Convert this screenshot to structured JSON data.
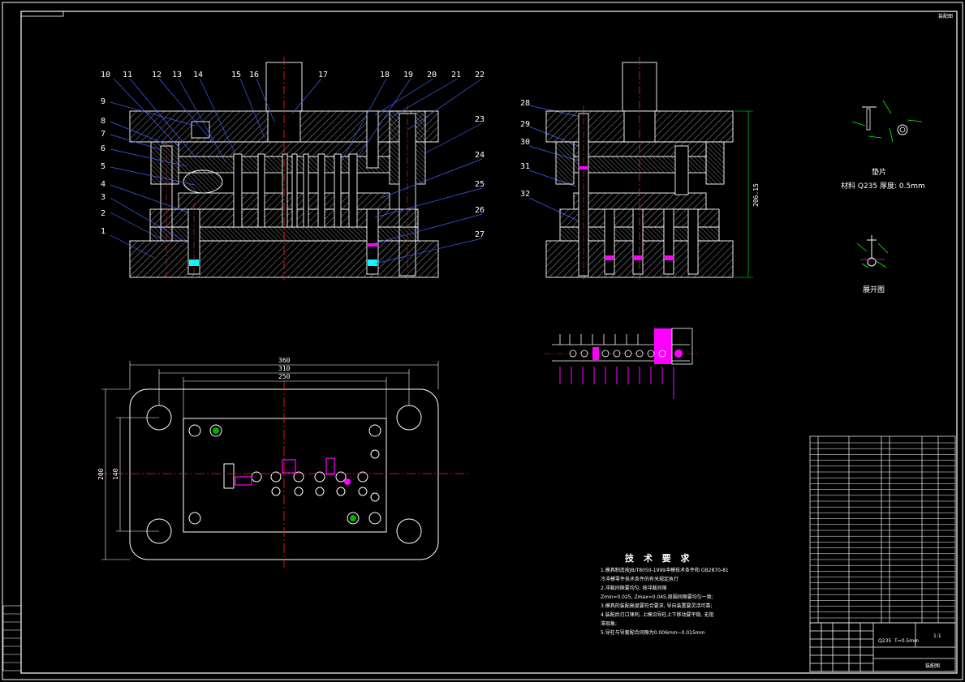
{
  "drawing": {
    "corner_tag": "装配图",
    "part_labels_left": [
      "1",
      "2",
      "3",
      "4",
      "5",
      "6",
      "7",
      "8",
      "9"
    ],
    "part_labels_top": [
      "10",
      "11",
      "12",
      "13",
      "14",
      "15",
      "16",
      "17",
      "18",
      "19",
      "20",
      "21",
      "22"
    ],
    "part_labels_right": [
      "23",
      "24",
      "25",
      "26",
      "27"
    ],
    "part_labels_side": [
      "28",
      "29",
      "30",
      "31",
      "32"
    ],
    "height_dim": "206.15",
    "dim_width_outer": "360",
    "dim_width_mid": "310",
    "dim_width_inner": "250",
    "dim_height_outer": "200",
    "dim_height_inner": "140"
  },
  "part_view": {
    "title": "垫片",
    "material_line": "材料 Q235  厚度: 0.5mm",
    "unfold_title": "展开图"
  },
  "tech_requirements": {
    "title": "技 术 要 求",
    "lines": [
      "1.模具制造按JB/T8050-1999冲模技术条件和 GB2870-81",
      "冷冲模零件技术条件的有关规定执行",
      "2.冲裁间隙要均匀, 按冲裁间隙",
      "Zmin=0.025, Zmax=0.045,周围间隙要均匀一致;",
      "3.模具的装配高度要符合要求, 导向装置要灵活可靠;",
      "4.装配后刃口锋利, 上模沿导柱上下移动要平稳, 无阻",
      "滞现象;",
      "5.导柱与导套配合间隙为0.006mm~0.015mm"
    ]
  },
  "title_block": {
    "drawing_name": "装配图",
    "scale_text": "1:1",
    "material_text": "Q235",
    "thickness_text": "T=0.5mm"
  },
  "colors": {
    "background": "#000000",
    "lines": "#ffffff",
    "centerline": "#ff2020",
    "dimension": "#00ff00",
    "leader": "#4060ff",
    "accent": "#ff00ff",
    "cyan": "#00ffff"
  }
}
